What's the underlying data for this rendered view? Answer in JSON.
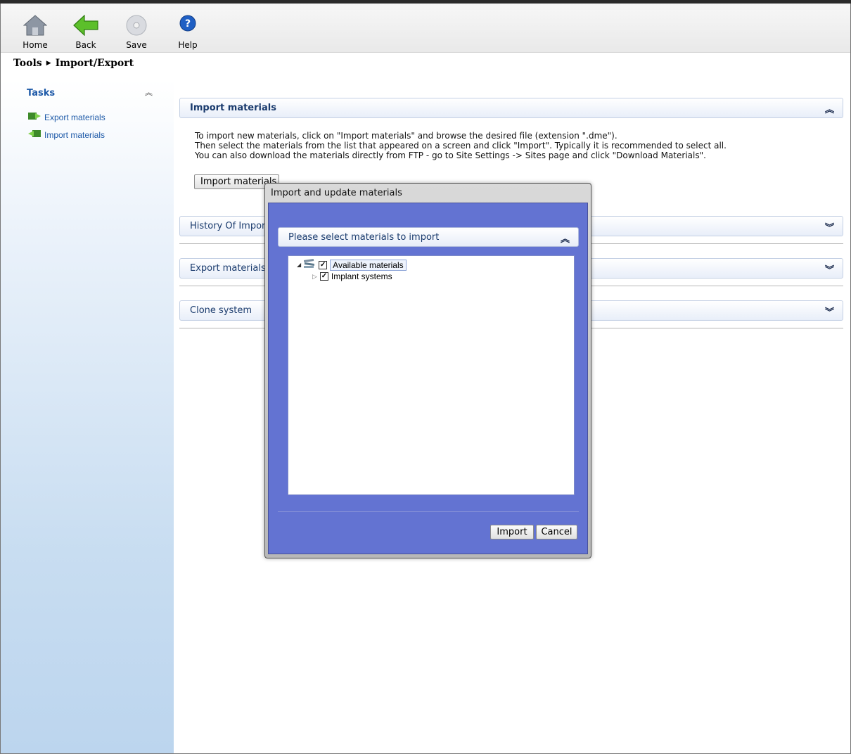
{
  "toolbar": {
    "home_label": "Home",
    "back_label": "Back",
    "save_label": "Save",
    "help_label": "Help"
  },
  "breadcrumb": {
    "root": "Tools",
    "current": "Import/Export"
  },
  "sidebar": {
    "title": "Tasks",
    "items": [
      {
        "label": "Export materials"
      },
      {
        "label": "Import materials"
      }
    ]
  },
  "panels": {
    "import": {
      "title": "Import materials",
      "desc": [
        "To import new materials, click on \"Import materials\" and browse the desired file (extension \".dme\").",
        "Then select the materials from the list that appeared on a screen and click \"Import\". Typically it is recommended to select all.",
        "You can also download the materials directly from FTP - go to Site Settings -> Sites page and click \"Download Materials\"."
      ],
      "button_label": "Import materials"
    },
    "history": {
      "title": "History Of Imports"
    },
    "export": {
      "title": "Export materials"
    },
    "clone": {
      "title": "Clone system"
    }
  },
  "dialog": {
    "title": "Import and update materials",
    "section_title": "Please select materials to import",
    "tree": [
      {
        "label": "Available materials",
        "checked": true
      },
      {
        "label": "Implant systems",
        "checked": true
      }
    ],
    "import_label": "Import",
    "cancel_label": "Cancel"
  },
  "colors": {
    "dialog_body": "#6373d2",
    "link": "#1e5aa8"
  }
}
